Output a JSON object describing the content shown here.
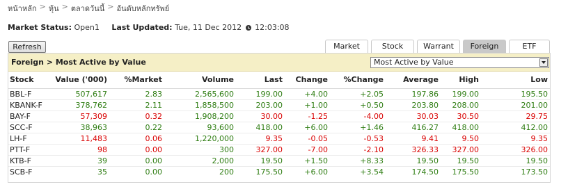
{
  "breadcrumb": [
    "หน้าหลัก",
    "หุ้น",
    "ตลาดวันนี้",
    "อันดับหลักทรัพย์"
  ],
  "breadcrumb_separator": ">",
  "status": {
    "market_label": "Market Status:",
    "market_value": "Open1",
    "updated_label": "Last Updated:",
    "updated_value": "Tue, 11 Dec 2012",
    "time_value": "12:03:08"
  },
  "refresh_label": "Refresh",
  "tabs": [
    {
      "label": "Market",
      "active": false
    },
    {
      "label": "Stock",
      "active": false
    },
    {
      "label": "Warrant",
      "active": false
    },
    {
      "label": "Foreign",
      "active": true
    },
    {
      "label": "ETF",
      "active": false
    }
  ],
  "panel_title": "Foreign > Most Active by Value",
  "select_value": "Most Active by Value",
  "columns": [
    "Stock",
    "Value ('000)",
    "%Market",
    "Volume",
    "Last",
    "Change",
    "%Change",
    "Average",
    "High",
    "Low"
  ],
  "rows": [
    {
      "stock": "BBL-F",
      "value": "507,617",
      "market": "2.83",
      "volume": "2,565,600",
      "last": "199.00",
      "change": "+4.00",
      "pchange": "+2.05",
      "average": "197.86",
      "high": "199.00",
      "low": "195.50",
      "dir": "up"
    },
    {
      "stock": "KBANK-F",
      "value": "378,762",
      "market": "2.11",
      "volume": "1,858,500",
      "last": "203.00",
      "change": "+1.00",
      "pchange": "+0.50",
      "average": "203.80",
      "high": "208.00",
      "low": "201.00",
      "dir": "up"
    },
    {
      "stock": "BAY-F",
      "value": "57,309",
      "market": "0.32",
      "volume": "1,908,200",
      "last": "30.00",
      "change": "-1.25",
      "pchange": "-4.00",
      "average": "30.03",
      "high": "30.50",
      "low": "29.75",
      "dir": "down"
    },
    {
      "stock": "SCC-F",
      "value": "38,963",
      "market": "0.22",
      "volume": "93,600",
      "last": "418.00",
      "change": "+6.00",
      "pchange": "+1.46",
      "average": "416.27",
      "high": "418.00",
      "low": "412.00",
      "dir": "up"
    },
    {
      "stock": "LH-F",
      "value": "11,483",
      "market": "0.06",
      "volume": "1,220,000",
      "last": "9.35",
      "change": "-0.05",
      "pchange": "-0.53",
      "average": "9.41",
      "high": "9.50",
      "low": "9.35",
      "dir": "down"
    },
    {
      "stock": "PTT-F",
      "value": "98",
      "market": "0.00",
      "volume": "300",
      "last": "327.00",
      "change": "-7.00",
      "pchange": "-2.10",
      "average": "326.33",
      "high": "327.00",
      "low": "326.00",
      "dir": "down"
    },
    {
      "stock": "KTB-F",
      "value": "39",
      "market": "0.00",
      "volume": "2,000",
      "last": "19.50",
      "change": "+1.50",
      "pchange": "+8.33",
      "average": "19.50",
      "high": "19.50",
      "low": "19.50",
      "dir": "up"
    },
    {
      "stock": "SCB-F",
      "value": "35",
      "market": "0.00",
      "volume": "200",
      "last": "175.50",
      "change": "+6.00",
      "pchange": "+3.54",
      "average": "174.50",
      "high": "175.50",
      "low": "173.50",
      "dir": "up"
    }
  ],
  "colors": {
    "up": "#2e7d12",
    "down": "#d90000",
    "titlebar": "#f5efc6",
    "active_tab": "#c9c9c9"
  },
  "icons": {
    "time": "clock-icon",
    "dropdown": "chevron-down-icon"
  }
}
